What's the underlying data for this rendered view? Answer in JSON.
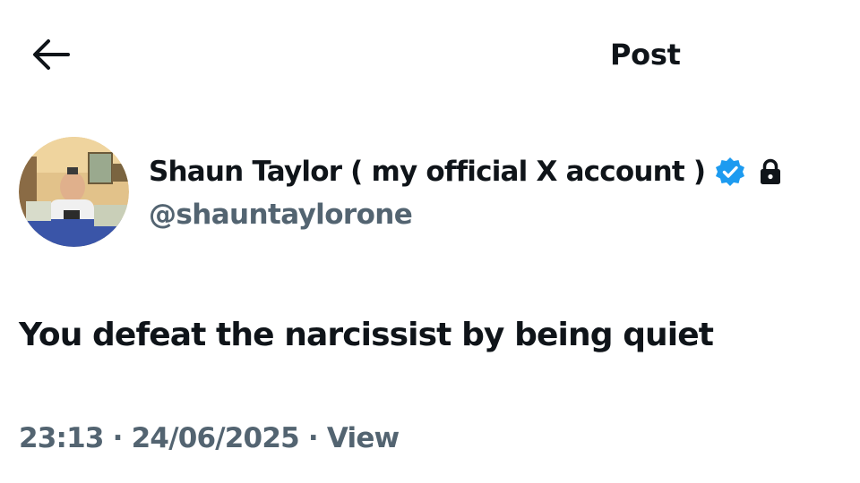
{
  "header": {
    "back_icon": "arrow-left-icon",
    "title": "Post"
  },
  "author": {
    "display_name": "Shaun Taylor ( my official X account )",
    "handle": "@shauntaylorone",
    "verified_icon": "verified-badge-icon",
    "protected_icon": "lock-icon",
    "verified_color": "#1d9bf0"
  },
  "post": {
    "text": "You defeat the narcissist by being quiet"
  },
  "meta": {
    "time": "23:13",
    "separator_1": " · ",
    "date": "24/06/2025",
    "separator_2": " · ",
    "views_label": "View"
  },
  "colors": {
    "text_primary": "#0f1419",
    "text_secondary": "#536471",
    "background": "#ffffff"
  }
}
